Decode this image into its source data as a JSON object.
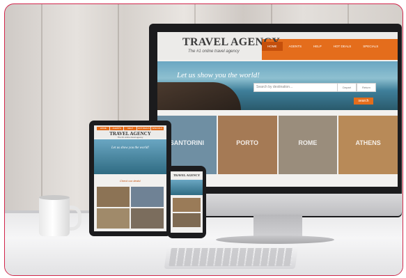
{
  "monitor": {
    "logo": "TRAVEL AGENCY",
    "tagline": "The #1 online travel agency",
    "nav": [
      "HOME",
      "AGENTS",
      "HELP",
      "HOT DEALS",
      "SPECIALS"
    ],
    "hero_text": "Let us show you the world!",
    "search_placeholder": "Search by destination...",
    "select_1": "Depart",
    "select_2": "Return",
    "search_button": "search",
    "tiles": [
      "SANTORINI",
      "PORTO",
      "ROME",
      "ATHENS"
    ],
    "tile_colors": [
      "#6f8fa3",
      "#a57a55",
      "#9a8d7c",
      "#b88a58"
    ]
  },
  "tablet": {
    "logo": "TRAVEL AGENCY",
    "tagline": "The #1 online travel agency",
    "nav": [
      "HOME",
      "AGENTS",
      "HELP",
      "HOT DEALS",
      "SPECIALS"
    ],
    "hero_text": "Let us show you the world!",
    "section_title": "Check our deals!"
  },
  "phone": {
    "logo": "TRAVEL AGENCY"
  },
  "colors": {
    "accent": "#e46d1c",
    "border": "#d2244a"
  }
}
